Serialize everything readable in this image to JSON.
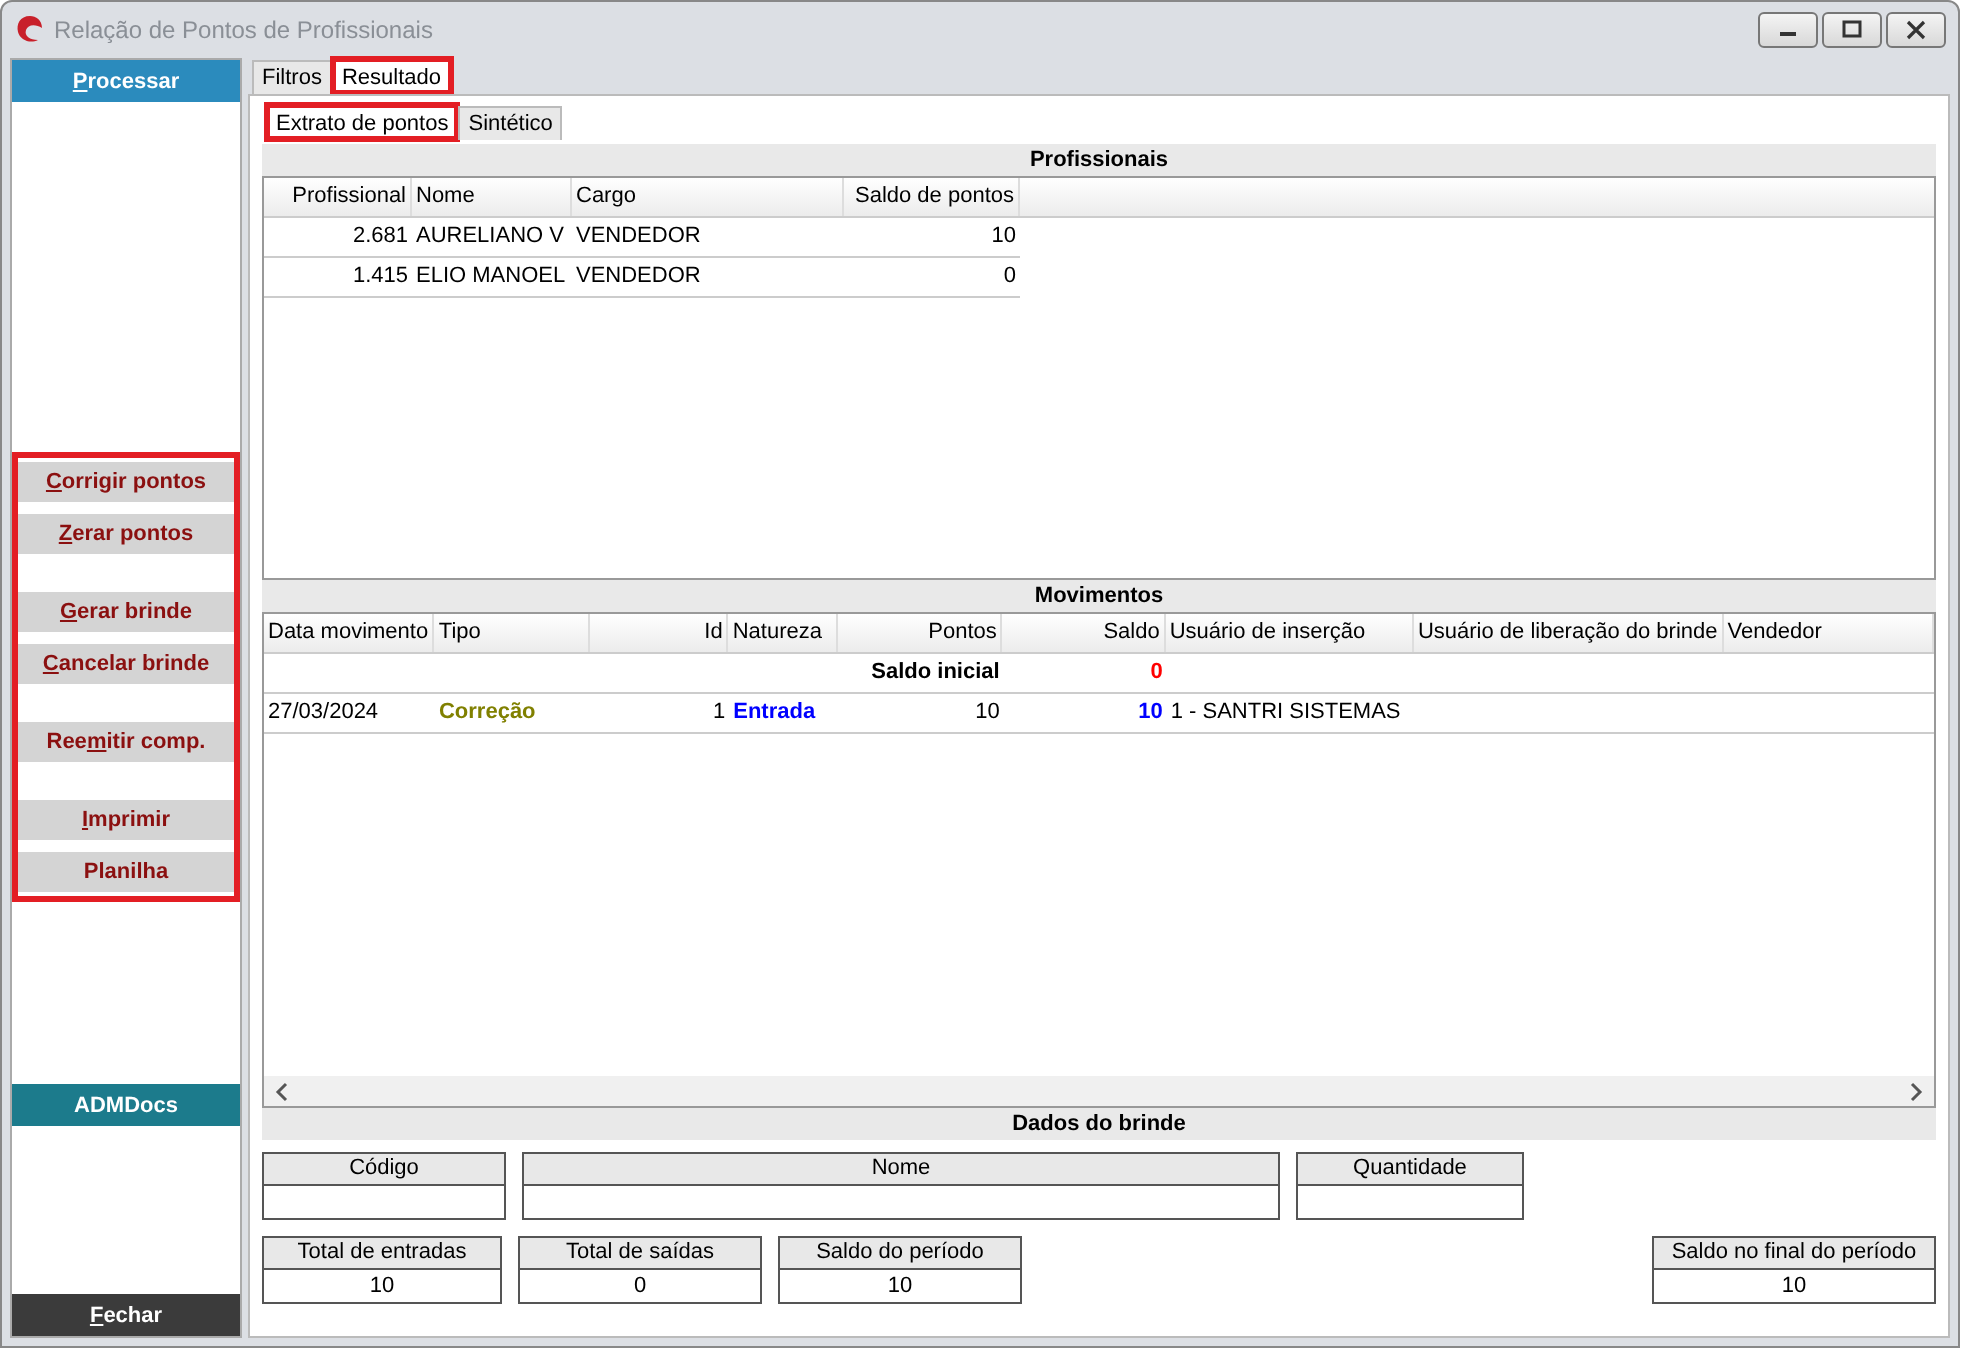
{
  "window": {
    "title": "Relação de Pontos de Profissionais"
  },
  "sidebar": {
    "top_button": {
      "key": "P",
      "rest": "rocessar"
    },
    "action_groups": {
      "highlighted": true,
      "groups": [
        [
          {
            "key": "C",
            "rest": "orrigir pontos"
          },
          {
            "key": "Z",
            "rest": "erar pontos"
          }
        ],
        [
          {
            "key": "G",
            "rest": "erar brinde"
          },
          {
            "key": "C",
            "rest": "ancelar brinde"
          }
        ],
        [
          {
            "pre": "Ree",
            "key": "m",
            "rest": "itir comp."
          }
        ],
        [
          {
            "key": "I",
            "rest": "mprimir"
          },
          {
            "rest": "Planilha"
          }
        ]
      ]
    },
    "docs_button": {
      "label": "ADMDocs"
    },
    "close_button": {
      "key": "F",
      "rest": "echar"
    }
  },
  "tabs": [
    {
      "label": "Filtros",
      "selected": false,
      "highlighted": false
    },
    {
      "label": "Resultado",
      "selected": true,
      "highlighted": true
    }
  ],
  "subtabs": [
    {
      "label": "Extrato de pontos",
      "selected": true,
      "highlighted": true
    },
    {
      "label": "Sintético",
      "selected": false,
      "highlighted": false
    }
  ],
  "professionals": {
    "title": "Profissionais",
    "columns": [
      "Profissional",
      "Nome",
      "Cargo",
      "Saldo de pontos"
    ],
    "rows": [
      [
        "2.681",
        "AURELIANO V",
        "VENDEDOR",
        "10"
      ],
      [
        "1.415",
        "ELIO MANOEL",
        "VENDEDOR",
        "0"
      ]
    ]
  },
  "movements": {
    "title": "Movimentos",
    "columns": [
      "Data movimento",
      "Tipo",
      "Id",
      "Natureza",
      "Pontos",
      "Saldo",
      "Usuário de inserção",
      "Usuário de liberação do brinde",
      "Vendedor"
    ],
    "rows": [
      [
        null,
        null,
        null,
        null,
        {
          "text": "Saldo inicial",
          "bold": true
        },
        {
          "text": "0",
          "color": "#ff0000"
        },
        null,
        null,
        null
      ],
      [
        {
          "text": "27/03/2024"
        },
        {
          "text": "Correção",
          "color": "#808000"
        },
        {
          "text": "1"
        },
        {
          "text": "Entrada",
          "color": "#0000ff"
        },
        {
          "text": "10"
        },
        {
          "text": "10",
          "color": "#0000ff"
        },
        {
          "text": "1 - SANTRI SISTEMAS"
        },
        null,
        null
      ]
    ]
  },
  "gift": {
    "title": "Dados do brinde",
    "fields": [
      {
        "label": "Código"
      },
      {
        "label": "Nome"
      },
      {
        "label": "Quantidade"
      }
    ]
  },
  "totals": [
    {
      "label": "Total de entradas",
      "value": "10"
    },
    {
      "label": "Total de saídas",
      "value": "0"
    },
    {
      "label": "Saldo do período",
      "value": "10"
    },
    {
      "label": "Saldo no final do período",
      "value": "10"
    }
  ]
}
